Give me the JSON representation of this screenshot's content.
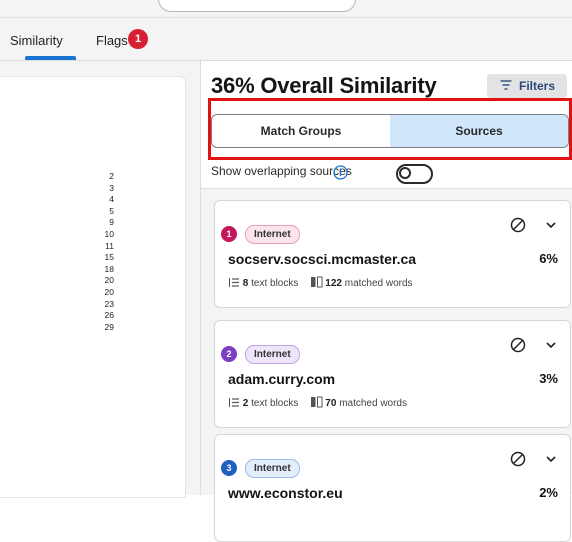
{
  "tabs": {
    "similarity_label": "Similarity",
    "flags_label": "Flags",
    "flags_count": "1"
  },
  "document": {
    "line_numbers": [
      "2",
      "3",
      "4",
      "5",
      "9",
      "10",
      "11",
      "15",
      "18",
      "20",
      "20",
      "23",
      "26",
      "29"
    ]
  },
  "panel": {
    "title": "36% Overall Similarity",
    "filters_label": "Filters",
    "view_options": [
      "Match Groups",
      "Sources"
    ],
    "selected_view": "Sources",
    "overlap_label": "Show overlapping sources",
    "overlap_enabled": false
  },
  "sources": [
    {
      "number": "1",
      "type": "Internet",
      "name": "socserv.socsci.mcmaster.ca",
      "percent": "6%",
      "text_blocks": "8",
      "text_blocks_label": "text blocks",
      "matched_words": "122",
      "matched_words_label": "matched words",
      "badge_color": "#c2185b",
      "pill_color": "#fce4ec",
      "pill_border": "#e8a0b8"
    },
    {
      "number": "2",
      "type": "Internet",
      "name": "adam.curry.com",
      "percent": "3%",
      "text_blocks": "2",
      "text_blocks_label": "text blocks",
      "matched_words": "70",
      "matched_words_label": "matched words",
      "badge_color": "#7b3fc4",
      "pill_color": "#efe5fb",
      "pill_border": "#bfa3e3"
    },
    {
      "number": "3",
      "type": "Internet",
      "name": "www.econstor.eu",
      "percent": "2%",
      "text_blocks": "",
      "text_blocks_label": "",
      "matched_words": "",
      "matched_words_label": "",
      "badge_color": "#1f5fc0",
      "pill_color": "#e3eefc",
      "pill_border": "#9dbbe8"
    }
  ],
  "colors": {
    "accent": "#1a75d2",
    "selected_segment": "#cfe6fb",
    "flag_badge": "#d81f34",
    "highlight_outline": "#e01212"
  }
}
